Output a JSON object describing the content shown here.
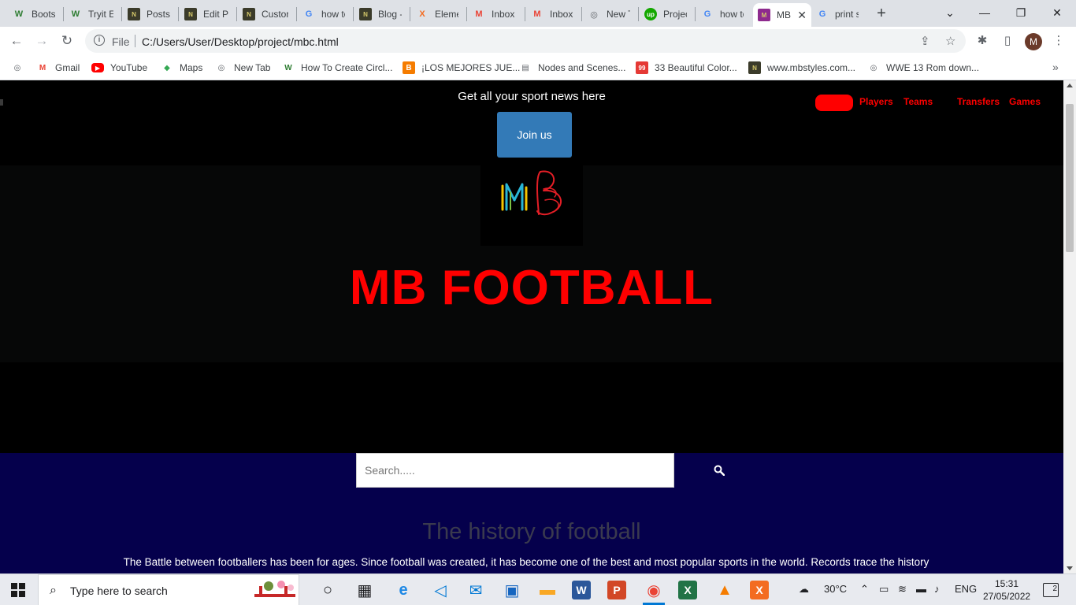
{
  "browser": {
    "tabs": [
      {
        "title": "Bootst",
        "icon": "w-icon",
        "color": "#2e7d32",
        "glyph": "W",
        "active": false
      },
      {
        "title": "Tryit E",
        "icon": "w-icon",
        "color": "#2e7d32",
        "glyph": "W",
        "active": false
      },
      {
        "title": "Posts",
        "icon": "n-icon",
        "color": "#3b3b2a",
        "glyph": "N",
        "active": false
      },
      {
        "title": "Edit Pr",
        "icon": "n-icon",
        "color": "#3b3b2a",
        "glyph": "N",
        "active": false
      },
      {
        "title": "Custor",
        "icon": "n-icon",
        "color": "#3b3b2a",
        "glyph": "N",
        "active": false
      },
      {
        "title": "how to",
        "icon": "google-icon",
        "color": "#4285f4",
        "glyph": "G",
        "active": false
      },
      {
        "title": "Blog -",
        "icon": "n-icon",
        "color": "#3b3b2a",
        "glyph": "N",
        "active": false
      },
      {
        "title": "Eleme",
        "icon": "xampp-icon",
        "color": "#f36c21",
        "glyph": "X",
        "active": false
      },
      {
        "title": "Inbox",
        "icon": "gmail-icon",
        "color": "#ea4335",
        "glyph": "M",
        "active": false
      },
      {
        "title": "Inbox",
        "icon": "gmail-icon",
        "color": "#ea4335",
        "glyph": "M",
        "active": false
      },
      {
        "title": "New T",
        "icon": "chrome-icon",
        "color": "#5f6368",
        "glyph": "◎",
        "active": false
      },
      {
        "title": "Projec",
        "icon": "upwork-icon",
        "color": "#14a800",
        "glyph": "up",
        "active": false
      },
      {
        "title": "how to",
        "icon": "google-icon",
        "color": "#4285f4",
        "glyph": "G",
        "active": false
      },
      {
        "title": "MB",
        "icon": "mb-icon",
        "color": "#8e2a8e",
        "glyph": "M",
        "active": true
      },
      {
        "title": "print s",
        "icon": "google-icon",
        "color": "#4285f4",
        "glyph": "G",
        "active": false
      }
    ],
    "address": {
      "scheme_label": "File",
      "url": "C:/Users/User/Desktop/project/mbc.html"
    },
    "profile_initial": "M",
    "bookmarks": [
      {
        "label": "",
        "icon": "globe-icon",
        "glyph": "◎",
        "color": "#5f6368"
      },
      {
        "label": "Gmail",
        "icon": "gmail-icon",
        "glyph": "M",
        "color": "#ea4335"
      },
      {
        "label": "YouTube",
        "icon": "youtube-icon",
        "glyph": "▶",
        "color": "#ff0000"
      },
      {
        "label": "Maps",
        "icon": "maps-icon",
        "glyph": "◆",
        "color": "#34a853"
      },
      {
        "label": "New Tab",
        "icon": "globe-icon",
        "glyph": "◎",
        "color": "#5f6368"
      },
      {
        "label": "How To Create Circl...",
        "icon": "w-icon",
        "glyph": "W",
        "color": "#2e7d32"
      },
      {
        "label": "¡LOS MEJORES JUE...",
        "icon": "blogger-icon",
        "glyph": "B",
        "color": "#f57c00"
      },
      {
        "label": "Nodes and Scenes...",
        "icon": "doc-icon",
        "glyph": "▤",
        "color": "#5f6368"
      },
      {
        "label": "33 Beautiful Color...",
        "icon": "99d-icon",
        "glyph": "99",
        "color": "#e53935"
      },
      {
        "label": "www.mbstyles.com...",
        "icon": "n-icon",
        "glyph": "N",
        "color": "#3b3b2a"
      },
      {
        "label": "WWE 13 Rom down...",
        "icon": "globe-icon",
        "glyph": "◎",
        "color": "#5f6368"
      }
    ]
  },
  "page": {
    "tagline": "Get all your sport news here",
    "join_label": "Join us",
    "nav": [
      "Players",
      "Teams",
      "Transfers",
      "Games"
    ],
    "title": "MB FOOTBALL",
    "logo_text": "MB",
    "search_placeholder": "Search.....",
    "history_title": "The history of football",
    "history_text": "The Battle between footballers has been for ages. Since football was created, it has become one of the best and most popular sports in the world. Records trace the history",
    "colors": {
      "accent": "#ff0000",
      "join_button": "#337ab7",
      "search_band": "#05004c"
    }
  },
  "taskbar": {
    "search_placeholder": "Type here to search",
    "weather": "30°C",
    "language": "ENG",
    "time": "15:31",
    "date": "27/05/2022",
    "notifications": "2",
    "apps": [
      {
        "name": "task-view",
        "glyph": "○",
        "color": "#202124"
      },
      {
        "name": "widgets",
        "glyph": "▦",
        "color": "#202124"
      },
      {
        "name": "edge",
        "glyph": "e",
        "color": "#1e88e5"
      },
      {
        "name": "vscode",
        "glyph": "◁",
        "color": "#0078d4"
      },
      {
        "name": "mail",
        "glyph": "✉",
        "color": "#0078d4"
      },
      {
        "name": "store",
        "glyph": "▣",
        "color": "#1565c0"
      },
      {
        "name": "file-explorer",
        "glyph": "▬",
        "color": "#f9a825"
      },
      {
        "name": "word",
        "glyph": "W",
        "color": "#2b579a"
      },
      {
        "name": "powerpoint",
        "glyph": "P",
        "color": "#d24726"
      },
      {
        "name": "chrome",
        "glyph": "◉",
        "color": "#ea4335"
      },
      {
        "name": "excel",
        "glyph": "X",
        "color": "#217346"
      },
      {
        "name": "vlc",
        "glyph": "▲",
        "color": "#f57c00"
      },
      {
        "name": "xampp",
        "glyph": "X",
        "color": "#f36c21"
      }
    ]
  }
}
